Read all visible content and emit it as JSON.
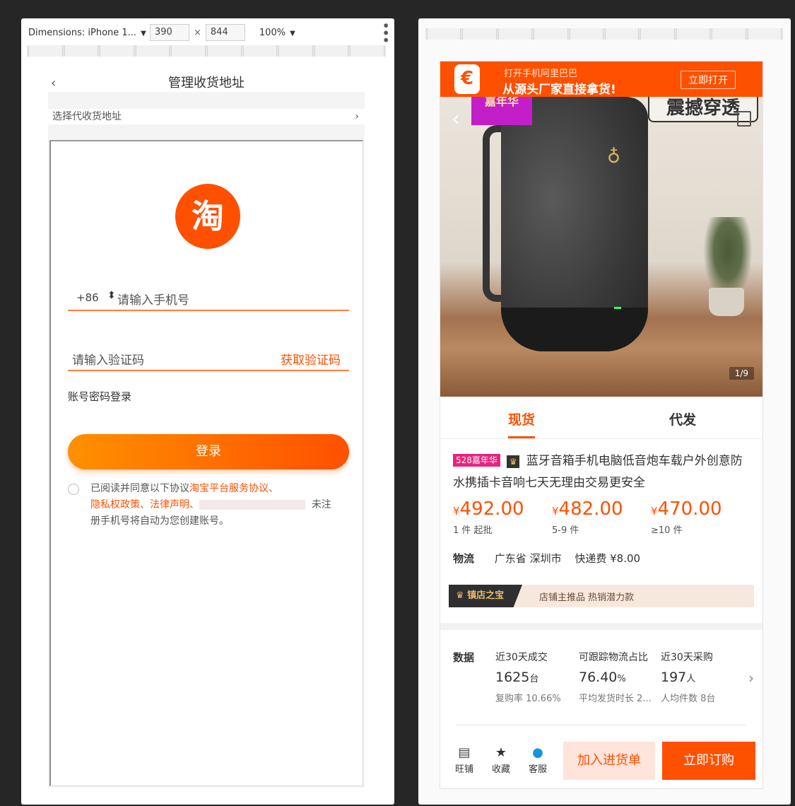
{
  "devtools": {
    "device": "Dimensions: iPhone 1...",
    "width": "390",
    "height": "844",
    "zoom": "100%"
  },
  "left": {
    "header_title": "管理收货地址",
    "back_glyph": "‹",
    "select_address": "选择代收货地址",
    "select_chevron": "›",
    "logo_char": "淘",
    "country_code": "+86",
    "phone_placeholder": "请输入手机号",
    "code_placeholder": "请输入验证码",
    "get_code": "获取验证码",
    "password_login": "账号密码登录",
    "login_button": "登录",
    "agree_prefix": "已阅读并同意以下协议",
    "agree_link1": "淘宝平台服务协议、",
    "agree_link2": "隐私权政策、法律声明、",
    "agree_suffix1": "未注",
    "agree_suffix2": "册手机号将自动为您创建账号。"
  },
  "right": {
    "banner": {
      "icon_char": "€",
      "line1": "打开手机阿里巴巴",
      "line2": "从源头厂家直接拿货!",
      "open_button": "立即打开"
    },
    "image": {
      "promo_tag": "嘉年华",
      "slogan": "震撼穿透",
      "back_glyph": "‹",
      "counter": "1/9"
    },
    "tabs": {
      "active": "现货",
      "other": "代发"
    },
    "title": {
      "badge": "528嘉年华",
      "crown": "♛",
      "text": "蓝牙音箱手机电脑低音炮车载户外创意防水携插卡音响七天无理由交易更安全"
    },
    "prices": [
      {
        "currency": "¥",
        "value": "492.00",
        "qty": "1 件 起批"
      },
      {
        "currency": "¥",
        "value": "482.00",
        "qty": "5-9 件"
      },
      {
        "currency": "¥",
        "value": "470.00",
        "qty": "≥10 件"
      }
    ],
    "logistics": {
      "label": "物流",
      "location": "广东省 深圳市",
      "fee": "快递费 ¥8.00"
    },
    "store_bar": {
      "badge": "♛ 镇店之宝",
      "text": "店铺主推品  热销潜力款"
    },
    "stats": {
      "label": "数据",
      "items": [
        {
          "title": "近30天成交",
          "value": "1625",
          "unit": "台",
          "sub": "复购率 10.66%"
        },
        {
          "title": "可跟踪物流占比",
          "value": "76.40",
          "unit": "%",
          "sub": "平均发货时长 2..."
        },
        {
          "title": "近30天采购",
          "value": "197",
          "unit": "人",
          "sub": "人均件数 8台"
        }
      ],
      "chevron": "›"
    },
    "bottom": {
      "shop_label": "旺铺",
      "fav_label": "收藏",
      "service_label": "客服",
      "cart_button": "加入进货单",
      "buy_button": "立即订购"
    }
  }
}
